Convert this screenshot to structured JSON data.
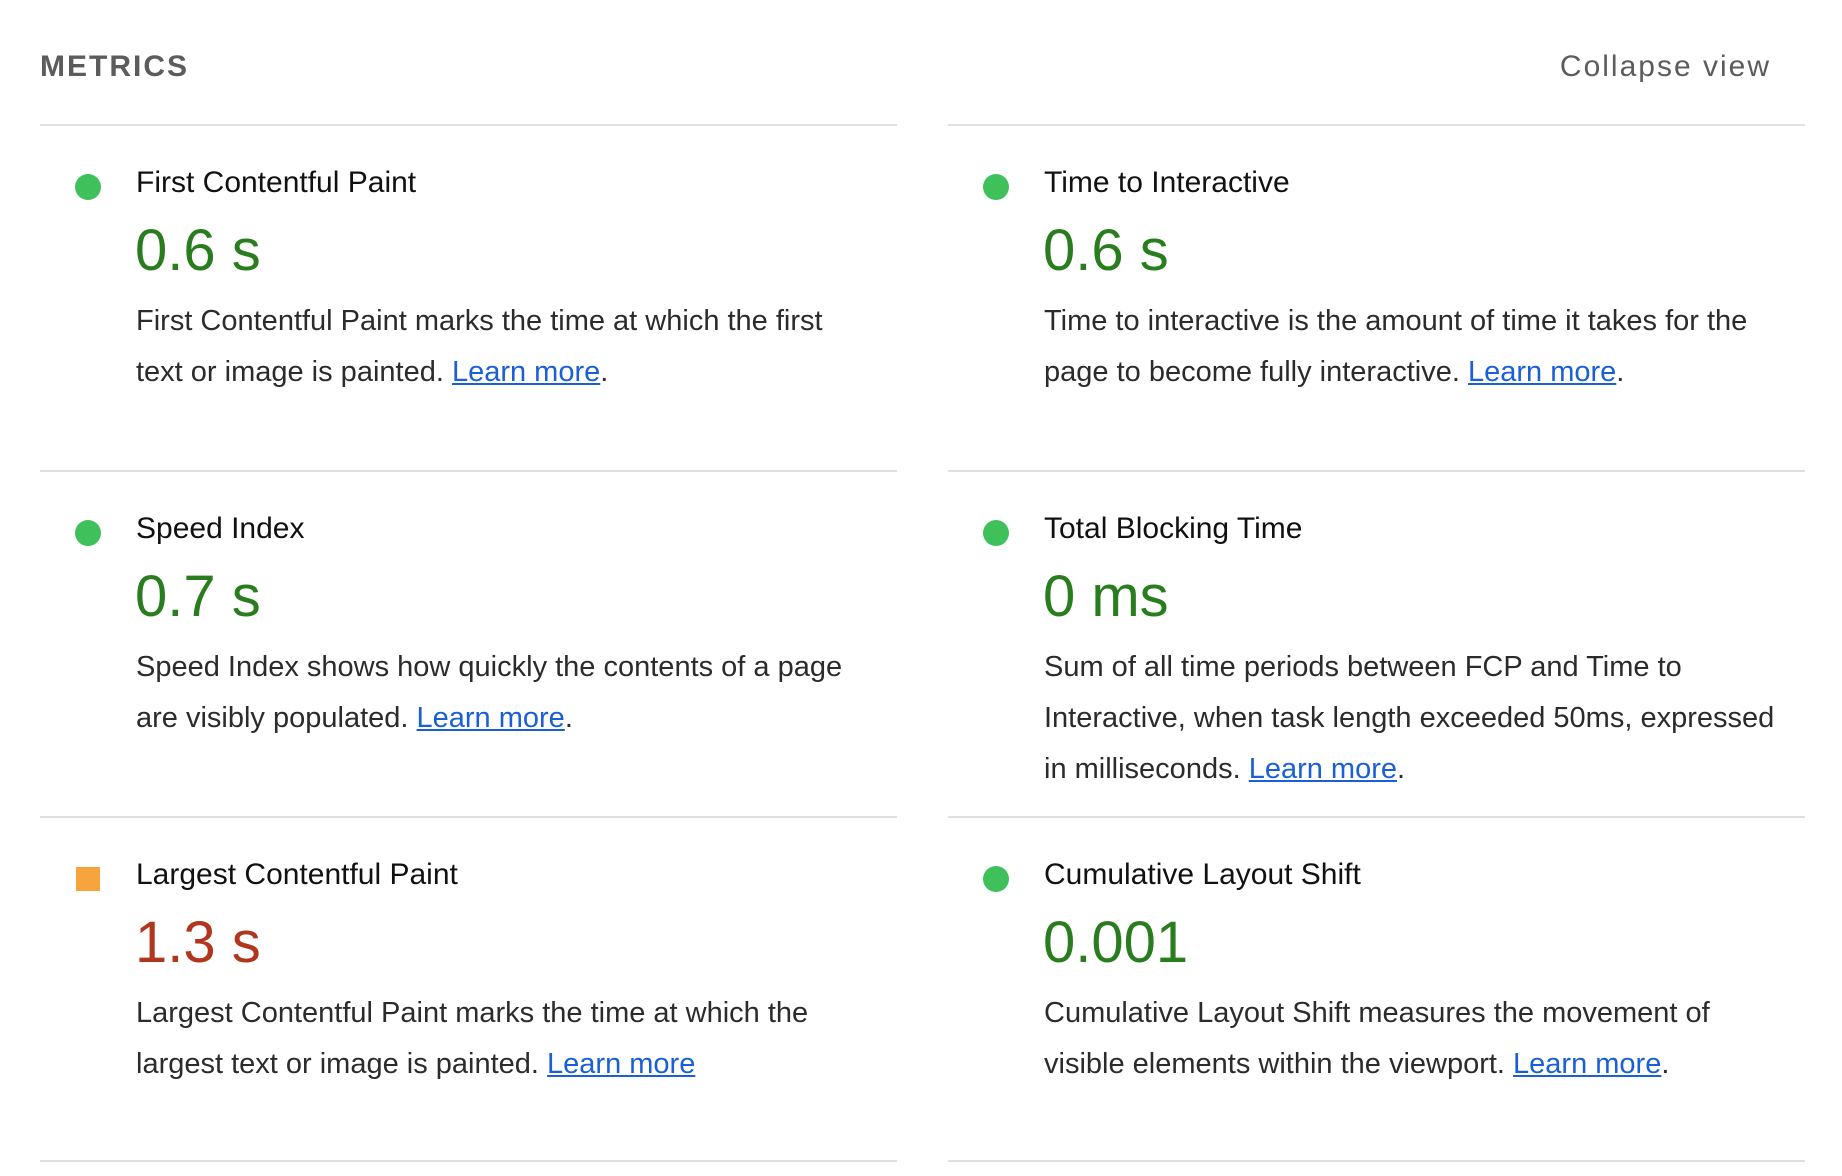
{
  "header": {
    "title": "METRICS",
    "collapse_label": "Collapse view"
  },
  "colors": {
    "pass_indicator": "#3fc05b",
    "pass_value": "#2a7d1f",
    "average_indicator": "#f7a43c",
    "average_value": "#b1361e",
    "link": "#1a5fd6"
  },
  "metrics": [
    {
      "title": "First Contentful Paint",
      "value": "0.6 s",
      "status": "pass",
      "indicator_icon": "green-circle-icon",
      "description": "First Contentful Paint marks the time at which the first text or image is painted.",
      "link_text": "Learn more",
      "suffix": "."
    },
    {
      "title": "Time to Interactive",
      "value": "0.6 s",
      "status": "pass",
      "indicator_icon": "green-circle-icon",
      "description": "Time to interactive is the amount of time it takes for the page to become fully interactive.",
      "link_text": "Learn more",
      "suffix": "."
    },
    {
      "title": "Speed Index",
      "value": "0.7 s",
      "status": "pass",
      "indicator_icon": "green-circle-icon",
      "description": "Speed Index shows how quickly the contents of a page are visibly populated.",
      "link_text": "Learn more",
      "suffix": "."
    },
    {
      "title": "Total Blocking Time",
      "value": "0 ms",
      "status": "pass",
      "indicator_icon": "green-circle-icon",
      "description": "Sum of all time periods between FCP and Time to Interactive, when task length exceeded 50ms, expressed in milliseconds.",
      "link_text": "Learn more",
      "suffix": "."
    },
    {
      "title": "Largest Contentful Paint",
      "value": "1.3 s",
      "status": "average",
      "indicator_icon": "orange-square-icon",
      "description": "Largest Contentful Paint marks the time at which the largest text or image is painted.",
      "link_text": "Learn more",
      "suffix": ""
    },
    {
      "title": "Cumulative Layout Shift",
      "value": "0.001",
      "status": "pass",
      "indicator_icon": "green-circle-icon",
      "description": "Cumulative Layout Shift measures the movement of visible elements within the viewport.",
      "link_text": "Learn more",
      "suffix": "."
    }
  ]
}
